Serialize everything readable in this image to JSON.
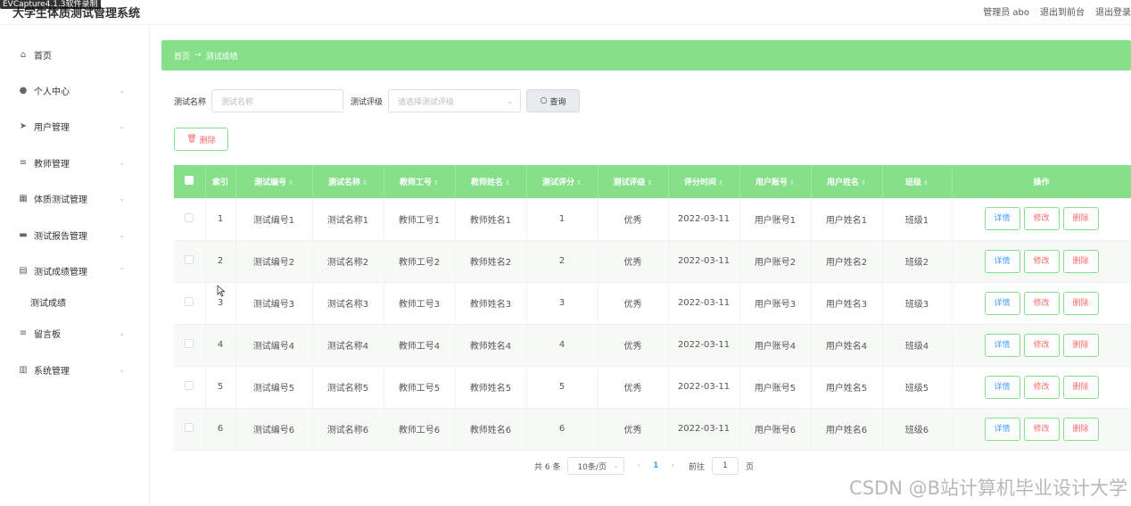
{
  "app": {
    "overlay_title": "EVCapture4.1.3软件录制",
    "title": "大学生体质测试管理系统",
    "header_links": [
      "管理员 abo",
      "退出到前台",
      "退出登录"
    ]
  },
  "sidebar": {
    "items": [
      {
        "label": "首页",
        "icon": "home-icon"
      },
      {
        "label": "个人中心",
        "icon": "user-icon"
      },
      {
        "label": "用户管理",
        "icon": "send-icon"
      },
      {
        "label": "教师管理",
        "icon": "list-icon"
      },
      {
        "label": "体质测试管理",
        "icon": "grid-icon"
      },
      {
        "label": "测试报告管理",
        "icon": "report-icon"
      },
      {
        "label": "测试成绩管理",
        "icon": "book-icon"
      },
      {
        "label": "测试成绩",
        "icon": ""
      },
      {
        "label": "留言板",
        "icon": "list-icon"
      },
      {
        "label": "系统管理",
        "icon": "bar-chart-icon"
      }
    ]
  },
  "breadcrumb": {
    "home": "首页",
    "arrow": "→",
    "current": "测试成绩"
  },
  "search": {
    "name_label": "测试名称",
    "name_placeholder": "测试名称",
    "grade_label": "测试评级",
    "grade_placeholder": "请选择测试评级",
    "query_label": "查询"
  },
  "toolbar": {
    "delete_label": "删除"
  },
  "table": {
    "headers": [
      "索引",
      "测试编号",
      "测试名称",
      "教师工号",
      "教师姓名",
      "测试评分",
      "测试评级",
      "评分时间",
      "用户账号",
      "用户姓名",
      "班级",
      "操作"
    ],
    "rows": [
      [
        "1",
        "测试编号1",
        "测试名称1",
        "教师工号1",
        "教师姓名1",
        "1",
        "优秀",
        "2022-03-11",
        "用户账号1",
        "用户姓名1",
        "班级1"
      ],
      [
        "2",
        "测试编号2",
        "测试名称2",
        "教师工号2",
        "教师姓名2",
        "2",
        "优秀",
        "2022-03-11",
        "用户账号2",
        "用户姓名2",
        "班级2"
      ],
      [
        "3",
        "测试编号3",
        "测试名称3",
        "教师工号3",
        "教师姓名3",
        "3",
        "优秀",
        "2022-03-11",
        "用户账号3",
        "用户姓名3",
        "班级3"
      ],
      [
        "4",
        "测试编号4",
        "测试名称4",
        "教师工号4",
        "教师姓名4",
        "4",
        "优秀",
        "2022-03-11",
        "用户账号4",
        "用户姓名4",
        "班级4"
      ],
      [
        "5",
        "测试编号5",
        "测试名称5",
        "教师工号5",
        "教师姓名5",
        "5",
        "优秀",
        "2022-03-11",
        "用户账号5",
        "用户姓名5",
        "班级5"
      ],
      [
        "6",
        "测试编号6",
        "测试名称6",
        "教师工号6",
        "教师姓名6",
        "6",
        "优秀",
        "2022-03-11",
        "用户账号6",
        "用户姓名6",
        "班级6"
      ]
    ],
    "actions": {
      "detail": "详情",
      "edit": "修改",
      "remove": "删除"
    }
  },
  "pagination": {
    "total": "共 6 条",
    "page_size": "10条/页",
    "prev": "‹",
    "current": "1",
    "next": "›",
    "goto_label": "前往",
    "goto_value": "1",
    "page_suffix": "页"
  },
  "watermark": "CSDN @B站计算机毕业设计大学",
  "colors": {
    "accent": "#86e08a",
    "link": "#409eff",
    "danger": "#f56c6c"
  }
}
